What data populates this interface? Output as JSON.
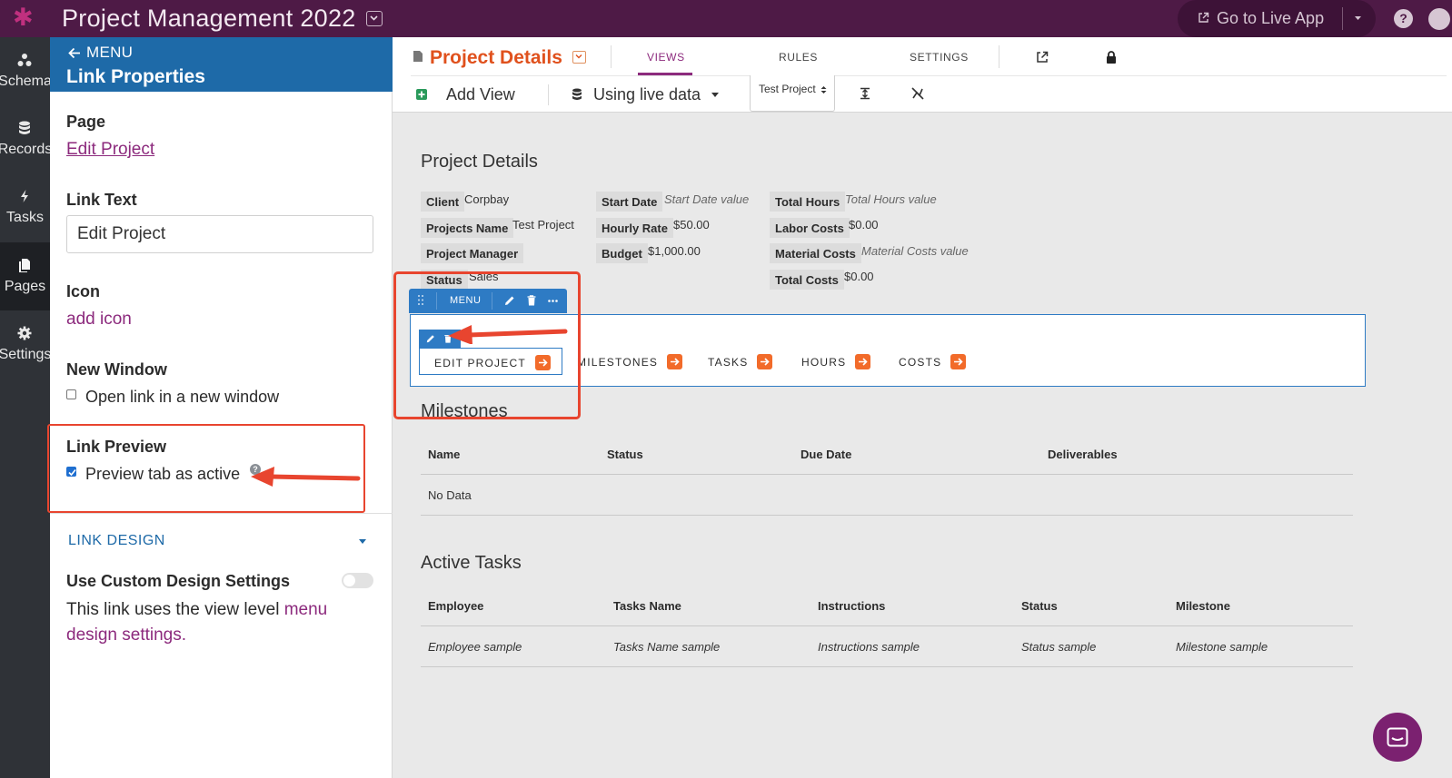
{
  "app": {
    "title": "Project Management 2022",
    "live_app_label": "Go to Live App",
    "help_label": "?"
  },
  "leftnav": [
    {
      "label": "Schema",
      "icon": "schema-icon"
    },
    {
      "label": "Records",
      "icon": "database-icon"
    },
    {
      "label": "Tasks",
      "icon": "bolt-icon"
    },
    {
      "label": "Pages",
      "icon": "pages-icon",
      "active": true
    },
    {
      "label": "Settings",
      "icon": "gear-icon"
    }
  ],
  "panel": {
    "back_label": "MENU",
    "title": "Link Properties",
    "page_label": "Page",
    "page_value": "Edit Project",
    "link_text_label": "Link Text",
    "link_text_value": "Edit Project",
    "icon_label": "Icon",
    "icon_action": "add icon",
    "new_window_label": "New Window",
    "new_window_option": "Open link in a new window",
    "new_window_checked": false,
    "link_preview_label": "Link Preview",
    "link_preview_option": "Preview tab as active",
    "link_preview_checked": true,
    "link_design_label": "LINK DESIGN",
    "custom_design_label": "Use Custom Design Settings",
    "custom_design_on": false,
    "design_text": "This link uses the view level",
    "design_link": "menu design settings."
  },
  "toolbar": {
    "page_title": "Project Details",
    "tabs": [
      "VIEWS",
      "RULES",
      "SETTINGS"
    ],
    "active_tab": "VIEWS",
    "add_view": "Add View",
    "live_data": "Using live data",
    "record_select": "Test Project"
  },
  "details": {
    "title": "Project Details",
    "col1": [
      {
        "label": "Client",
        "value": "Corpbay"
      },
      {
        "label": "Projects Name",
        "value": "Test Project"
      },
      {
        "label": "Project Manager",
        "value": ""
      },
      {
        "label": "Status",
        "value": "Sales"
      }
    ],
    "col2": [
      {
        "label": "Start Date",
        "value": "Start Date value"
      },
      {
        "label": "Hourly Rate",
        "value": "$50.00"
      },
      {
        "label": "Budget",
        "value": "$1,000.00"
      }
    ],
    "col3": [
      {
        "label": "Total Hours",
        "value": "Total Hours value"
      },
      {
        "label": "Labor Costs",
        "value": "$0.00"
      },
      {
        "label": "Material Costs",
        "value": "Material Costs value"
      },
      {
        "label": "Total Costs",
        "value": "$0.00"
      }
    ]
  },
  "menu_view": {
    "toolbar_label": "MENU",
    "links": [
      "EDIT PROJECT",
      "MILESTONES",
      "TASKS",
      "HOURS",
      "COSTS"
    ]
  },
  "milestones": {
    "title": "Milestones",
    "columns": [
      "Name",
      "Status",
      "Due Date",
      "Deliverables"
    ],
    "empty": "No Data"
  },
  "active_tasks": {
    "title": "Active Tasks",
    "columns": [
      "Employee",
      "Tasks Name",
      "Instructions",
      "Status",
      "Milestone"
    ],
    "row": [
      "Employee sample",
      "Tasks Name sample",
      "Instructions sample",
      "Status sample",
      "Milestone sample"
    ]
  },
  "colors": {
    "brand": "#4e1a46",
    "accent": "#8c2a7d",
    "primary": "#1e6aa8",
    "highlight": "#e8452f",
    "link_arrow": "#f26b2a"
  }
}
